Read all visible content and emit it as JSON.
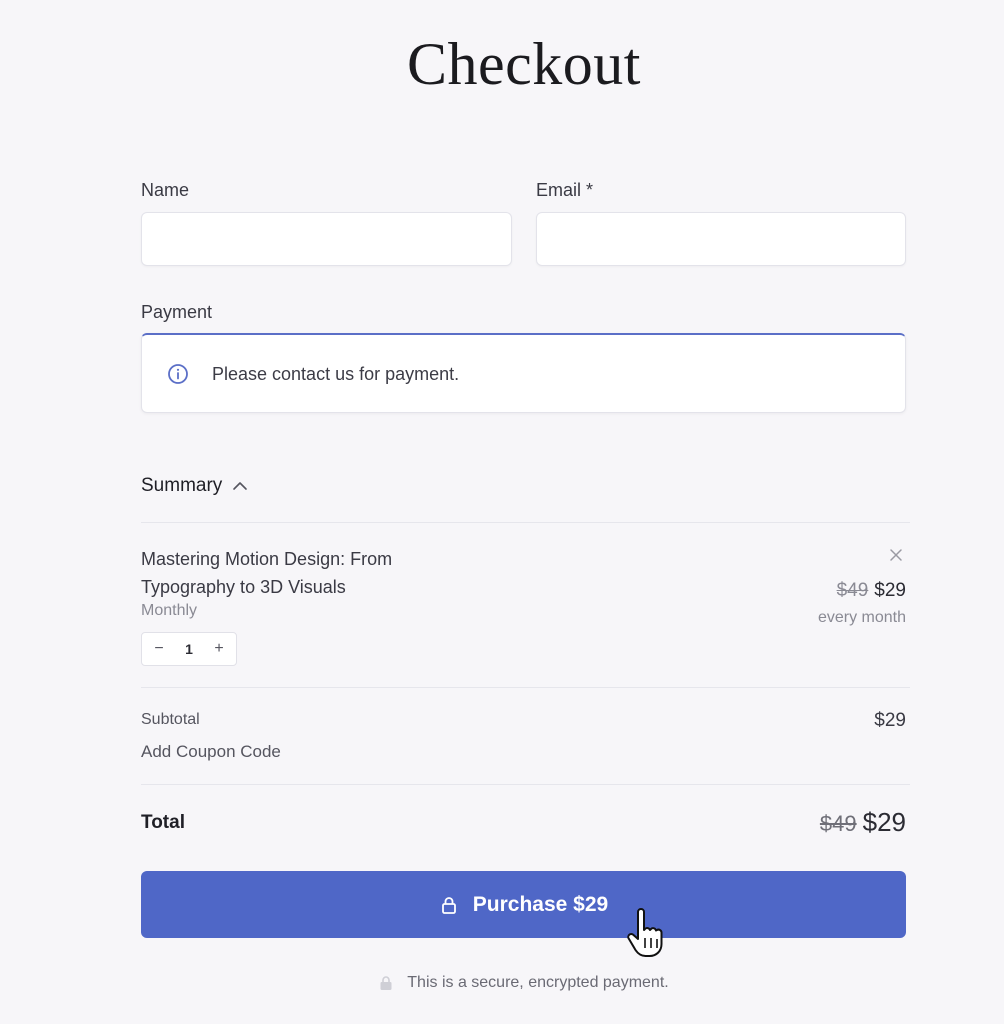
{
  "page": {
    "title": "Checkout"
  },
  "form": {
    "name_label": "Name",
    "name_value": "",
    "email_label": "Email *",
    "email_value": "",
    "payment_label": "Payment",
    "payment_message": "Please contact us for payment."
  },
  "summary": {
    "label": "Summary",
    "product_name": "Mastering Motion Design: From Typography to 3D Visuals",
    "plan": "Monthly",
    "quantity": "1",
    "decrement_symbol": "−",
    "increment_symbol": "+",
    "original_price": "$49",
    "price": "$29",
    "billing_period": "every month",
    "subtotal_label": "Subtotal",
    "subtotal_value": "$29",
    "coupon_label": "Add Coupon Code",
    "total_label": "Total",
    "total_original": "$49",
    "total_value": "$29"
  },
  "purchase": {
    "button_label": "Purchase $29",
    "secure_note": "This is a secure, encrypted payment."
  },
  "icons": {
    "info": "info-icon",
    "chevron": "chevron-up-icon",
    "remove": "close-icon",
    "lock": "lock-icon",
    "cursor": "hand-pointer-icon"
  },
  "colors": {
    "accent": "#4f67c7",
    "background": "#f7f6f9",
    "input_border": "#e3e3ea",
    "payment_focus_border": "#5b6fc7"
  }
}
